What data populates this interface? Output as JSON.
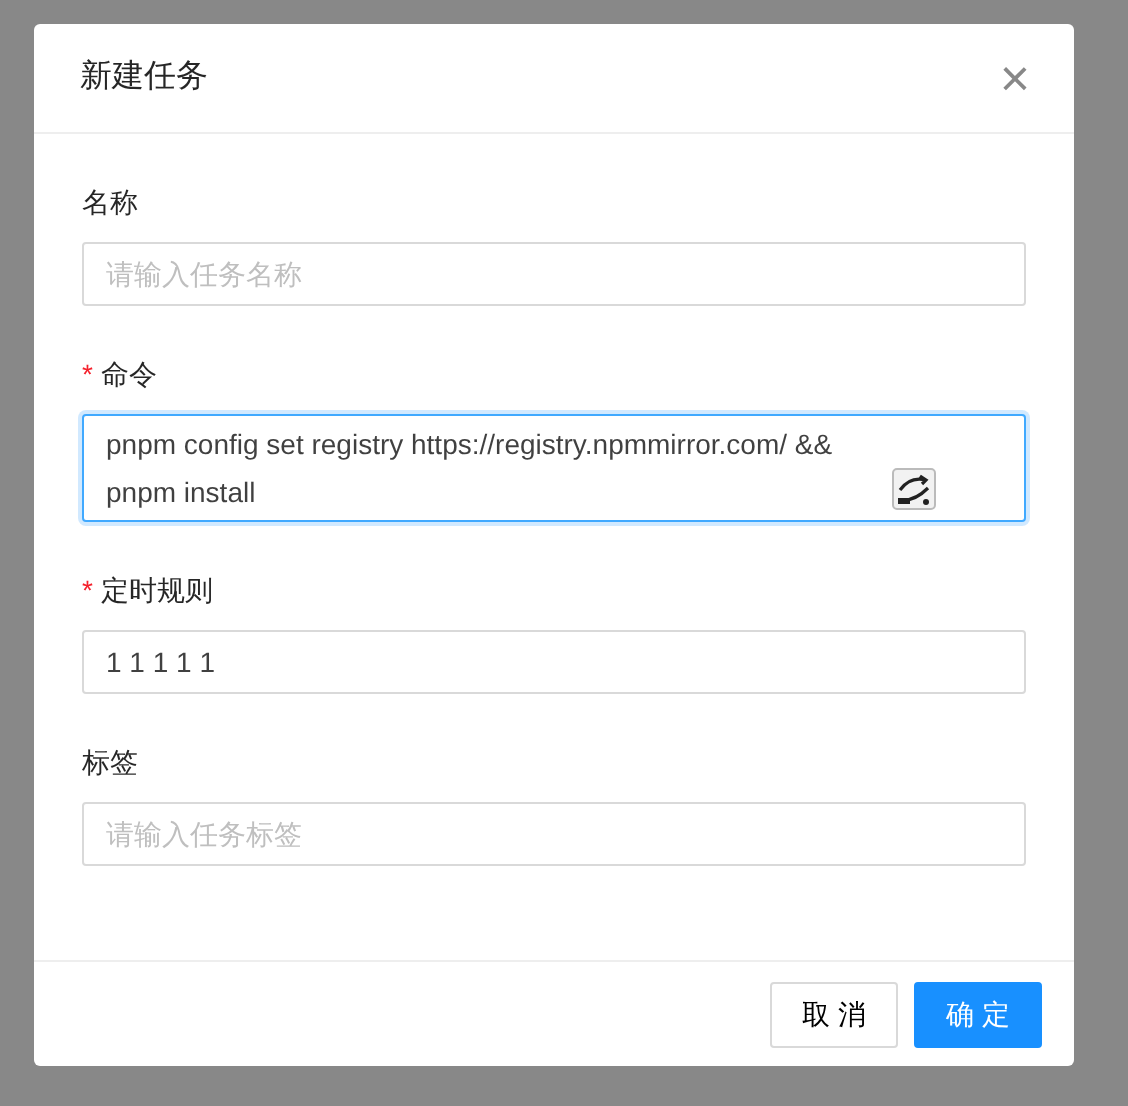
{
  "dialog": {
    "title": "新建任务",
    "close": "×"
  },
  "fields": [
    {
      "kind": "input",
      "label": "名称",
      "placeholder": "请输入任务名称",
      "focused": false
    },
    {
      "kind": "textarea",
      "required_mark": "*",
      "label": "命令",
      "value": "pnpm config set registry https://registry.npmmirror.com/ && pnpm install",
      "focused": true
    },
    {
      "kind": "input",
      "required_mark": "*",
      "label": "定时规则",
      "value": "1 1 1 1 1",
      "focused": false
    },
    {
      "kind": "input",
      "label": "标签",
      "placeholder": "请输入任务标签",
      "focused": false
    }
  ],
  "buttons": [
    {
      "label": "取 消",
      "primary": false
    },
    {
      "label": "确 定",
      "primary": true
    }
  ]
}
